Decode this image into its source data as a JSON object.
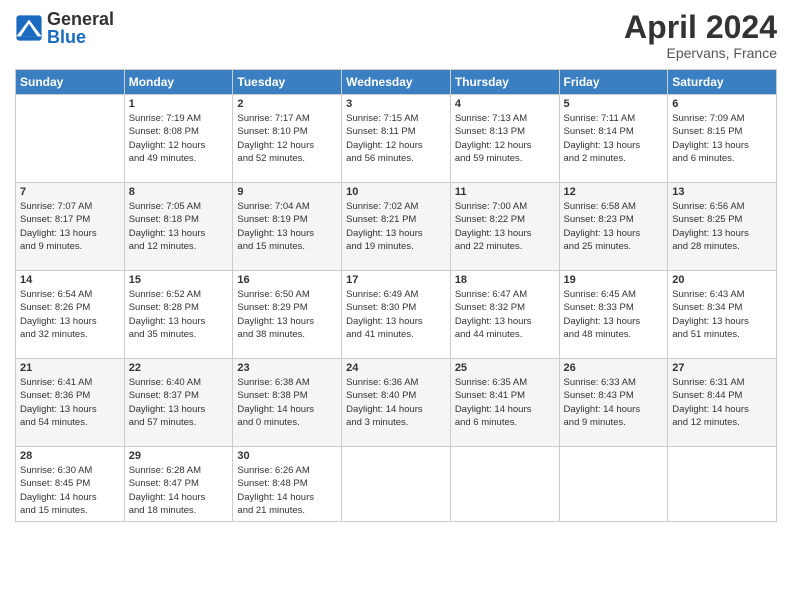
{
  "logo": {
    "general": "General",
    "blue": "Blue"
  },
  "title": {
    "month": "April 2024",
    "location": "Epervans, France"
  },
  "headers": [
    "Sunday",
    "Monday",
    "Tuesday",
    "Wednesday",
    "Thursday",
    "Friday",
    "Saturday"
  ],
  "weeks": [
    [
      {
        "day": "",
        "info": ""
      },
      {
        "day": "1",
        "info": "Sunrise: 7:19 AM\nSunset: 8:08 PM\nDaylight: 12 hours\nand 49 minutes."
      },
      {
        "day": "2",
        "info": "Sunrise: 7:17 AM\nSunset: 8:10 PM\nDaylight: 12 hours\nand 52 minutes."
      },
      {
        "day": "3",
        "info": "Sunrise: 7:15 AM\nSunset: 8:11 PM\nDaylight: 12 hours\nand 56 minutes."
      },
      {
        "day": "4",
        "info": "Sunrise: 7:13 AM\nSunset: 8:13 PM\nDaylight: 12 hours\nand 59 minutes."
      },
      {
        "day": "5",
        "info": "Sunrise: 7:11 AM\nSunset: 8:14 PM\nDaylight: 13 hours\nand 2 minutes."
      },
      {
        "day": "6",
        "info": "Sunrise: 7:09 AM\nSunset: 8:15 PM\nDaylight: 13 hours\nand 6 minutes."
      }
    ],
    [
      {
        "day": "7",
        "info": "Sunrise: 7:07 AM\nSunset: 8:17 PM\nDaylight: 13 hours\nand 9 minutes."
      },
      {
        "day": "8",
        "info": "Sunrise: 7:05 AM\nSunset: 8:18 PM\nDaylight: 13 hours\nand 12 minutes."
      },
      {
        "day": "9",
        "info": "Sunrise: 7:04 AM\nSunset: 8:19 PM\nDaylight: 13 hours\nand 15 minutes."
      },
      {
        "day": "10",
        "info": "Sunrise: 7:02 AM\nSunset: 8:21 PM\nDaylight: 13 hours\nand 19 minutes."
      },
      {
        "day": "11",
        "info": "Sunrise: 7:00 AM\nSunset: 8:22 PM\nDaylight: 13 hours\nand 22 minutes."
      },
      {
        "day": "12",
        "info": "Sunrise: 6:58 AM\nSunset: 8:23 PM\nDaylight: 13 hours\nand 25 minutes."
      },
      {
        "day": "13",
        "info": "Sunrise: 6:56 AM\nSunset: 8:25 PM\nDaylight: 13 hours\nand 28 minutes."
      }
    ],
    [
      {
        "day": "14",
        "info": "Sunrise: 6:54 AM\nSunset: 8:26 PM\nDaylight: 13 hours\nand 32 minutes."
      },
      {
        "day": "15",
        "info": "Sunrise: 6:52 AM\nSunset: 8:28 PM\nDaylight: 13 hours\nand 35 minutes."
      },
      {
        "day": "16",
        "info": "Sunrise: 6:50 AM\nSunset: 8:29 PM\nDaylight: 13 hours\nand 38 minutes."
      },
      {
        "day": "17",
        "info": "Sunrise: 6:49 AM\nSunset: 8:30 PM\nDaylight: 13 hours\nand 41 minutes."
      },
      {
        "day": "18",
        "info": "Sunrise: 6:47 AM\nSunset: 8:32 PM\nDaylight: 13 hours\nand 44 minutes."
      },
      {
        "day": "19",
        "info": "Sunrise: 6:45 AM\nSunset: 8:33 PM\nDaylight: 13 hours\nand 48 minutes."
      },
      {
        "day": "20",
        "info": "Sunrise: 6:43 AM\nSunset: 8:34 PM\nDaylight: 13 hours\nand 51 minutes."
      }
    ],
    [
      {
        "day": "21",
        "info": "Sunrise: 6:41 AM\nSunset: 8:36 PM\nDaylight: 13 hours\nand 54 minutes."
      },
      {
        "day": "22",
        "info": "Sunrise: 6:40 AM\nSunset: 8:37 PM\nDaylight: 13 hours\nand 57 minutes."
      },
      {
        "day": "23",
        "info": "Sunrise: 6:38 AM\nSunset: 8:38 PM\nDaylight: 14 hours\nand 0 minutes."
      },
      {
        "day": "24",
        "info": "Sunrise: 6:36 AM\nSunset: 8:40 PM\nDaylight: 14 hours\nand 3 minutes."
      },
      {
        "day": "25",
        "info": "Sunrise: 6:35 AM\nSunset: 8:41 PM\nDaylight: 14 hours\nand 6 minutes."
      },
      {
        "day": "26",
        "info": "Sunrise: 6:33 AM\nSunset: 8:43 PM\nDaylight: 14 hours\nand 9 minutes."
      },
      {
        "day": "27",
        "info": "Sunrise: 6:31 AM\nSunset: 8:44 PM\nDaylight: 14 hours\nand 12 minutes."
      }
    ],
    [
      {
        "day": "28",
        "info": "Sunrise: 6:30 AM\nSunset: 8:45 PM\nDaylight: 14 hours\nand 15 minutes."
      },
      {
        "day": "29",
        "info": "Sunrise: 6:28 AM\nSunset: 8:47 PM\nDaylight: 14 hours\nand 18 minutes."
      },
      {
        "day": "30",
        "info": "Sunrise: 6:26 AM\nSunset: 8:48 PM\nDaylight: 14 hours\nand 21 minutes."
      },
      {
        "day": "",
        "info": ""
      },
      {
        "day": "",
        "info": ""
      },
      {
        "day": "",
        "info": ""
      },
      {
        "day": "",
        "info": ""
      }
    ]
  ]
}
